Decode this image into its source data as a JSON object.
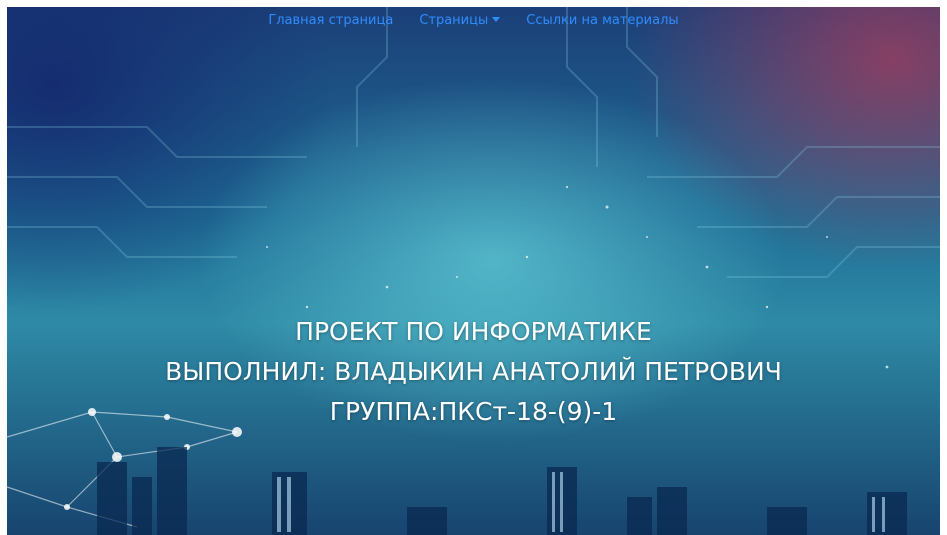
{
  "nav": {
    "items": [
      {
        "label": "Главная страница",
        "dropdown": false
      },
      {
        "label": "Страницы",
        "dropdown": true
      },
      {
        "label": "Ссылки на материалы",
        "dropdown": false
      }
    ],
    "link_color": "#2f8cff"
  },
  "hero": {
    "line1": "ПРОЕКТ ПО ИНФОРМАТИКЕ",
    "line2": "ВЫПОЛНИЛ: ВЛАДЫКИН АНАТОЛИЙ ПЕТРОВИЧ",
    "line3": "ГРУППА:ПКСт-18-(9)-1"
  }
}
